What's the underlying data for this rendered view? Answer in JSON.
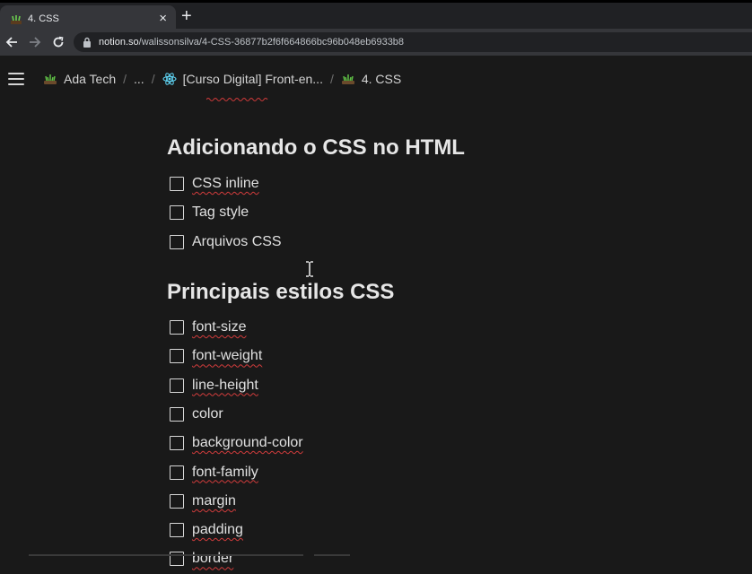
{
  "browser": {
    "tab_title": "4. CSS",
    "new_tab_symbol": "+",
    "close_symbol": "×",
    "url_host": "notion.so",
    "url_path": "/walissonsilva/4-CSS-36877b2f6f664866bc96b048eb6933b8"
  },
  "breadcrumb": {
    "items": [
      {
        "label": "Ada Tech",
        "icon": "plant-icon"
      },
      {
        "label": "..."
      },
      {
        "label": "[Curso Digital] Front-en...",
        "icon": "react-icon"
      },
      {
        "label": "4. CSS",
        "icon": "plant-icon"
      }
    ],
    "separator": "/"
  },
  "sections": [
    {
      "heading": "Adicionando o CSS no HTML",
      "items": [
        "CSS inline",
        "Tag style",
        "Arquivos CSS"
      ]
    },
    {
      "heading": "Principais estilos CSS",
      "items": [
        "font-size",
        "font-weight",
        "line-height",
        "color",
        "background-color",
        "font-family",
        "margin",
        "padding",
        "border"
      ]
    }
  ],
  "colors": {
    "page_background": "#191919",
    "tab_bar": "#202124",
    "toolbar": "#35363a",
    "spellcheck_underline": "#d23c3c",
    "react_blue": "#61dafb",
    "plant_green": "#4caf50"
  }
}
